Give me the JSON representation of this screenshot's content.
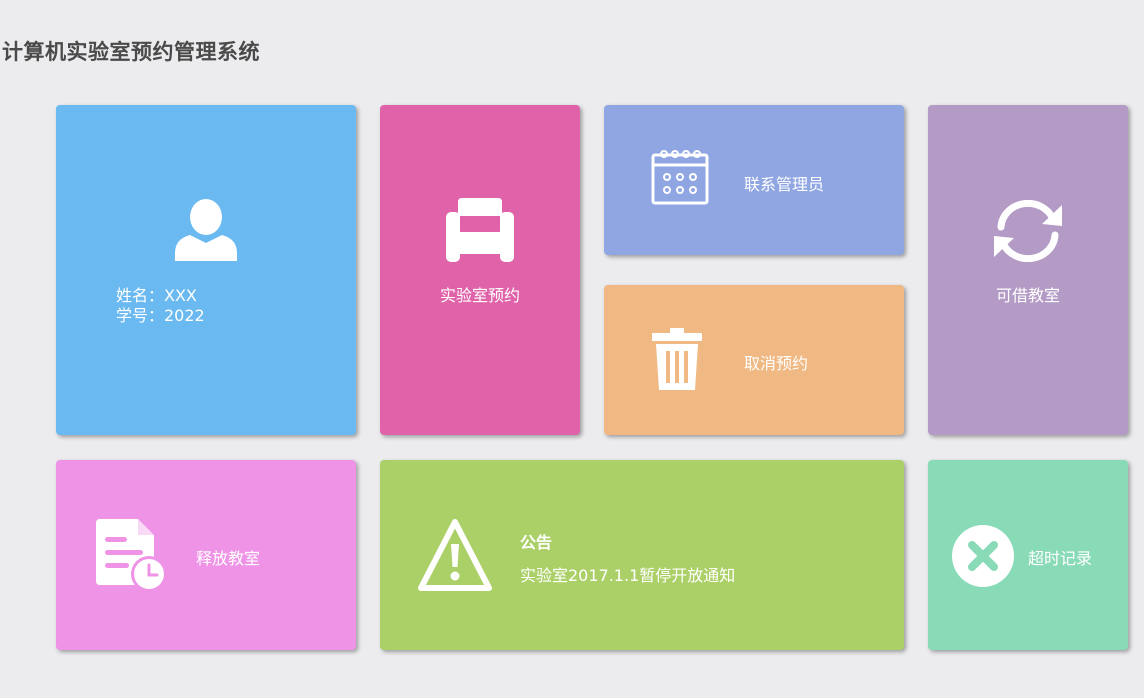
{
  "app": {
    "title": "计算机实验室预约管理系统"
  },
  "tiles": {
    "profile": {
      "name_line": "姓名：XXX",
      "id_line": "学号：2022",
      "icon": "user-icon",
      "color": "#6bb9f1"
    },
    "reserve": {
      "label": "实验室预约",
      "icon": "armchair-icon",
      "color": "#e063a9"
    },
    "contact": {
      "label": "联系管理员",
      "icon": "calendar-icon",
      "color": "#8fa6e2"
    },
    "cancel": {
      "label": "取消预约",
      "icon": "trash-icon",
      "color": "#f0b983"
    },
    "available": {
      "label": "可借教室",
      "icon": "refresh-icon",
      "color": "#b39bc6"
    },
    "release": {
      "label": "释放教室",
      "icon": "document-clock-icon",
      "color": "#ef93e6"
    },
    "notice": {
      "title": "公告",
      "text": "实验室2017.1.1暂停开放通知",
      "icon": "warning-icon",
      "color": "#acd068"
    },
    "overdue": {
      "label": "超时记录",
      "icon": "close-circle-icon",
      "color": "#89dbb8"
    }
  }
}
